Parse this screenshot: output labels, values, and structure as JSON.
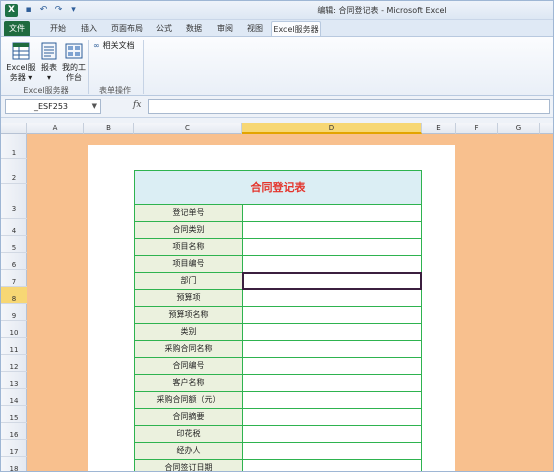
{
  "window": {
    "title": "编辑: 合同登记表 - Microsoft Excel",
    "app_icon": "X"
  },
  "tabs": [
    {
      "label": "文件",
      "kind": "file"
    },
    {
      "label": "开始"
    },
    {
      "label": "插入"
    },
    {
      "label": "页面布局"
    },
    {
      "label": "公式"
    },
    {
      "label": "数据"
    },
    {
      "label": "审阅"
    },
    {
      "label": "视图"
    },
    {
      "label": "Excel服务器",
      "active": true
    }
  ],
  "ribbon": {
    "excel_server_btn_line1": "Excel服",
    "excel_server_btn_line2": "务器",
    "report_btn": "报表",
    "my_desk_line1": "我的工",
    "my_desk_line2": "作台",
    "related_docs": "相关文档",
    "group1_label": "Excel服务器",
    "group2_label": "表单操作"
  },
  "formula_bar": {
    "name_box": "_ESF253",
    "fx": "fx",
    "formula": ""
  },
  "columns": [
    "A",
    "B",
    "C",
    "D",
    "E",
    "F",
    "G"
  ],
  "selected_column": "D",
  "rows": [
    "1",
    "2",
    "3",
    "4",
    "5",
    "6",
    "7",
    "8",
    "9",
    "10",
    "11",
    "12",
    "13",
    "14",
    "15",
    "16",
    "17",
    "18"
  ],
  "selected_row": "8",
  "form": {
    "title": "合同登记表",
    "fields": [
      "登记单号",
      "合同类别",
      "项目名称",
      "项目编号",
      "部门",
      "预算项",
      "预算项名称",
      "类别",
      "采购合同名称",
      "合同编号",
      "客户名称",
      "采购合同额（元）",
      "合同摘要",
      "印花税",
      "经办人",
      "合同签订日期"
    ],
    "active_field_index": 4
  },
  "colors": {
    "file_tab": "#1f6b3f",
    "sheet_background": "#f8c08e",
    "form_border": "#2eb34f",
    "form_title": "#e4332a",
    "form_title_bg": "#dbeef4",
    "label_bg": "#ebf1de",
    "selected_header": "#f7d774"
  }
}
